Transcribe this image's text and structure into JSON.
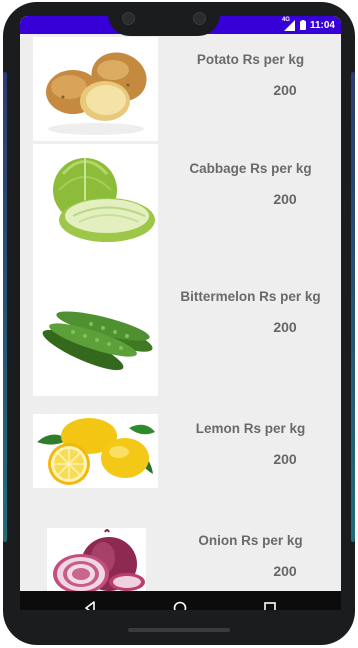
{
  "status_bar": {
    "network": "4G",
    "time": "11:04",
    "color": "#3600d6"
  },
  "products": [
    {
      "name": "Potato Rs per kg",
      "price": "200",
      "image": "potato-image"
    },
    {
      "name": "Cabbage Rs per kg",
      "price": "200",
      "image": "cabbage-image"
    },
    {
      "name": "Bittermelon Rs per kg",
      "price": "200",
      "image": "bittermelon-image"
    },
    {
      "name": "Lemon Rs per kg",
      "price": "200",
      "image": "lemon-image"
    },
    {
      "name": "Onion Rs per kg",
      "price": "200",
      "image": "onion-image"
    }
  ],
  "nav_bar": {
    "icons": [
      "back-icon",
      "home-icon",
      "recents-icon"
    ]
  }
}
